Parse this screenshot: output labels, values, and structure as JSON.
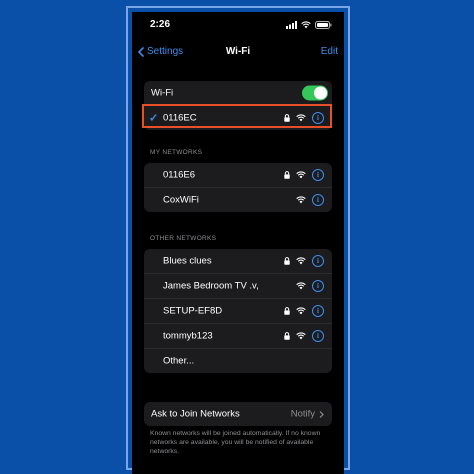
{
  "status_bar": {
    "time": "2:26"
  },
  "nav": {
    "back_label": "Settings",
    "title": "Wi-Fi",
    "edit_label": "Edit"
  },
  "wifi_toggle": {
    "label": "Wi-Fi",
    "on": true
  },
  "connected": {
    "name": "0116EC",
    "locked": true
  },
  "my_networks": {
    "header": "MY NETWORKS",
    "items": [
      {
        "name": "0116E6",
        "locked": true
      },
      {
        "name": "CoxWiFi",
        "locked": false
      }
    ]
  },
  "other_networks": {
    "header": "OTHER NETWORKS",
    "items": [
      {
        "name": "Blues clues",
        "locked": true
      },
      {
        "name": "James Bedroom TV .v,",
        "locked": false
      },
      {
        "name": "SETUP-EF8D",
        "locked": true
      },
      {
        "name": "tommyb123",
        "locked": true
      }
    ],
    "other_label": "Other..."
  },
  "ask_to_join": {
    "label": "Ask to Join Networks",
    "value": "Notify"
  },
  "footnote": "Known networks will be joined automatically. If no known networks are available, you will be notified of available networks.",
  "colors": {
    "accent": "#3b8ef0",
    "toggle_on": "#34c759",
    "highlight": "#e8502a",
    "background": "#0a4fa8"
  }
}
